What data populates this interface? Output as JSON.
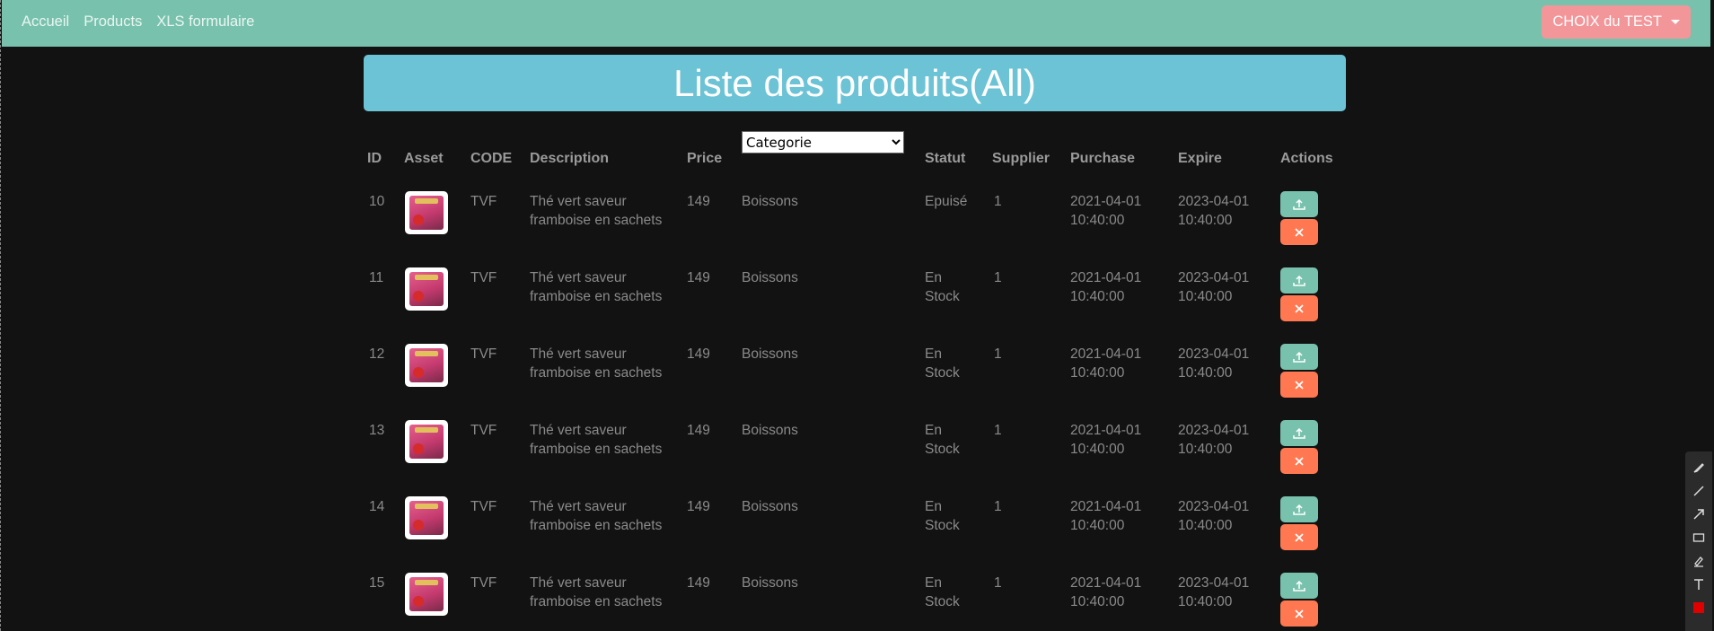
{
  "nav": {
    "links": [
      "Accueil",
      "Products",
      "XLS formulaire"
    ],
    "dropdown_label": "CHOIX du TEST"
  },
  "title": "Liste des produits(All)",
  "category_select": {
    "selected": "Categorie"
  },
  "table": {
    "headers": [
      "ID",
      "Asset",
      "CODE",
      "Description",
      "Price",
      "Statut",
      "Supplier",
      "Purchase",
      "Expire",
      "Actions"
    ],
    "rows": [
      {
        "id": "10",
        "code": "TVF",
        "desc1": "Thé vert saveur",
        "desc2": "framboise en sachets",
        "price": "149",
        "category": "Boissons",
        "statut1": "Epuisé",
        "statut2": "",
        "supplier": "1",
        "purchase1": "2021-04-01",
        "purchase2": "10:40:00",
        "expire1": "2023-04-01",
        "expire2": "10:40:00"
      },
      {
        "id": "11",
        "code": "TVF",
        "desc1": "Thé vert saveur",
        "desc2": "framboise en sachets",
        "price": "149",
        "category": "Boissons",
        "statut1": "En",
        "statut2": "Stock",
        "supplier": "1",
        "purchase1": "2021-04-01",
        "purchase2": "10:40:00",
        "expire1": "2023-04-01",
        "expire2": "10:40:00"
      },
      {
        "id": "12",
        "code": "TVF",
        "desc1": "Thé vert saveur",
        "desc2": "framboise en sachets",
        "price": "149",
        "category": "Boissons",
        "statut1": "En",
        "statut2": "Stock",
        "supplier": "1",
        "purchase1": "2021-04-01",
        "purchase2": "10:40:00",
        "expire1": "2023-04-01",
        "expire2": "10:40:00"
      },
      {
        "id": "13",
        "code": "TVF",
        "desc1": "Thé vert saveur",
        "desc2": "framboise en sachets",
        "price": "149",
        "category": "Boissons",
        "statut1": "En",
        "statut2": "Stock",
        "supplier": "1",
        "purchase1": "2021-04-01",
        "purchase2": "10:40:00",
        "expire1": "2023-04-01",
        "expire2": "10:40:00"
      },
      {
        "id": "14",
        "code": "TVF",
        "desc1": "Thé vert saveur",
        "desc2": "framboise en sachets",
        "price": "149",
        "category": "Boissons",
        "statut1": "En",
        "statut2": "Stock",
        "supplier": "1",
        "purchase1": "2021-04-01",
        "purchase2": "10:40:00",
        "expire1": "2023-04-01",
        "expire2": "10:40:00"
      },
      {
        "id": "15",
        "code": "TVF",
        "desc1": "Thé vert saveur",
        "desc2": "framboise en sachets",
        "price": "149",
        "category": "Boissons",
        "statut1": "En",
        "statut2": "Stock",
        "supplier": "1",
        "purchase1": "2021-04-01",
        "purchase2": "10:40:00",
        "expire1": "2023-04-01",
        "expire2": "10:40:00"
      }
    ]
  },
  "colors": {
    "navbar": "#78c2ad",
    "title_bar": "#6cc3d5",
    "dropdown_button": "#f3969a",
    "upload_button": "#78c2ad",
    "delete_button": "#ff7851",
    "background": "#121212"
  },
  "icons": {
    "upload": "upload-icon",
    "delete": "close-icon"
  },
  "drawing_toolbar": [
    "pen-icon",
    "line-icon",
    "arrow-icon",
    "rectangle-icon",
    "highlighter-icon",
    "text-icon",
    "color-swatch-icon"
  ]
}
